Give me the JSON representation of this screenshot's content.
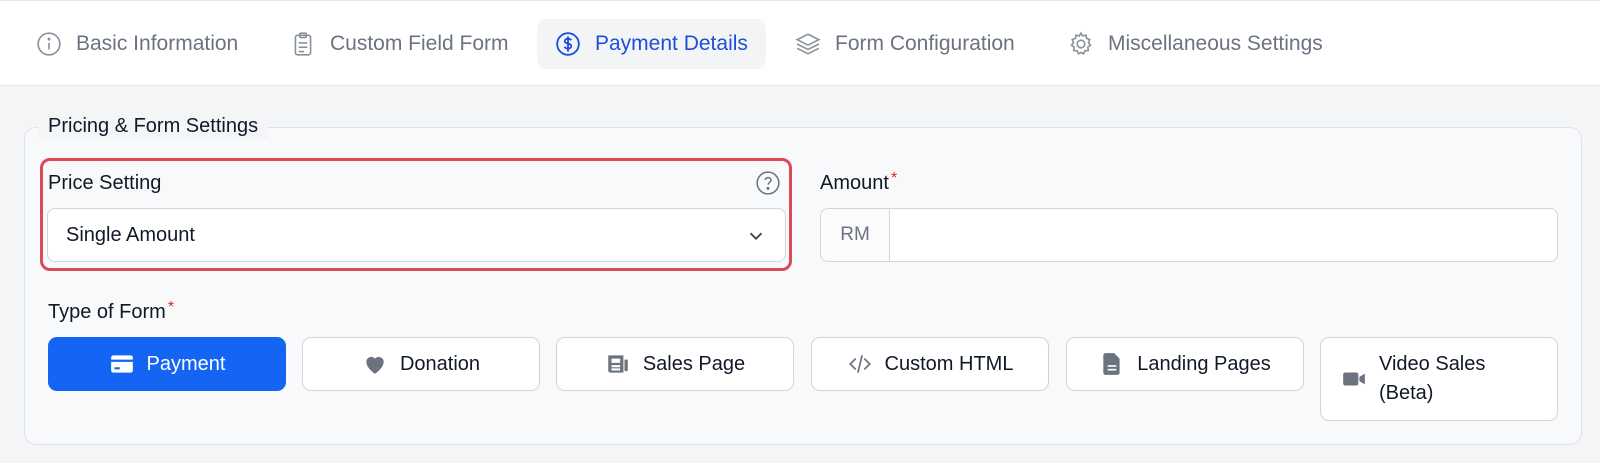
{
  "tabs": [
    {
      "label": "Basic Information",
      "icon": "info-icon"
    },
    {
      "label": "Custom Field Form",
      "icon": "clipboard-icon"
    },
    {
      "label": "Payment Details",
      "icon": "dollar-icon",
      "active": true
    },
    {
      "label": "Form Configuration",
      "icon": "layers-icon"
    },
    {
      "label": "Miscellaneous Settings",
      "icon": "gear-icon"
    }
  ],
  "section": {
    "title": "Pricing & Form Settings"
  },
  "price_setting": {
    "label": "Price Setting",
    "value": "Single Amount"
  },
  "amount": {
    "label": "Amount",
    "required_mark": "*",
    "prefix": "RM",
    "value": ""
  },
  "type_of_form": {
    "label": "Type of Form",
    "required_mark": "*",
    "options": [
      {
        "label": "Payment",
        "icon": "card-icon",
        "active": true
      },
      {
        "label": "Donation",
        "icon": "heart-icon"
      },
      {
        "label": "Sales Page",
        "icon": "newspaper-icon"
      },
      {
        "label": "Custom HTML",
        "icon": "code-icon"
      },
      {
        "label": "Landing Pages",
        "icon": "document-icon"
      },
      {
        "label": "Video Sales (Beta)",
        "icon": "video-icon"
      }
    ]
  },
  "colors": {
    "accent": "#1565f5",
    "active_tab": "#1d4ed8",
    "highlight": "#dc4a56",
    "required": "#dc2626"
  }
}
